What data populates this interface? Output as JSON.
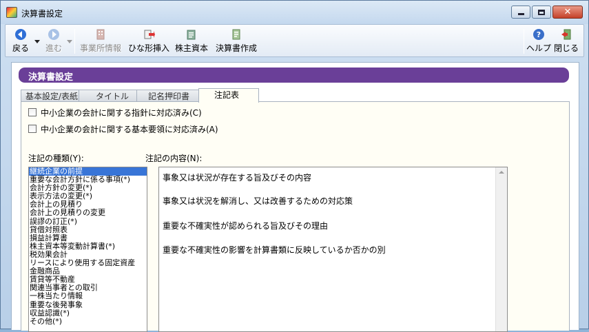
{
  "window": {
    "title": "決算書設定",
    "controls": {
      "minimize": "−",
      "maximize": "□",
      "close": "✕"
    }
  },
  "toolbar": {
    "back": {
      "label": "戻る",
      "icon": "back-arrow-icon"
    },
    "forward": {
      "label": "進む",
      "icon": "forward-arrow-icon"
    },
    "office_info": {
      "label": "事業所情報",
      "icon": "office-building-icon"
    },
    "insert_template": {
      "label": "ひな形挿入",
      "icon": "insert-template-icon"
    },
    "capital": {
      "label": "株主資本",
      "icon": "stock-capital-icon"
    },
    "create_statement": {
      "label": "決算書作成",
      "icon": "create-document-icon"
    },
    "help": {
      "label": "ヘルプ",
      "icon": "help-icon"
    },
    "close": {
      "label": "閉じる",
      "icon": "exit-door-icon"
    }
  },
  "header": {
    "title": "決算書設定"
  },
  "tabs": [
    {
      "label": "基本設定/表紙",
      "active": false
    },
    {
      "label": "タイトル",
      "active": false
    },
    {
      "label": "記名押印書",
      "active": false
    },
    {
      "label": "注記表",
      "active": true
    }
  ],
  "options": {
    "guideline_label": "中小企業の会計に関する指針に対応済み(C)",
    "guideline_checked": false,
    "basic_rule_label": "中小企業の会計に関する基本要領に対応済み(A)",
    "basic_rule_checked": false
  },
  "notes": {
    "kinds_label": "注記の種類(Y):",
    "content_label": "注記の内容(N):",
    "kinds": [
      "継続企業の前提",
      "重要な会計方針に係る事項(*)",
      "会計方針の変更(*)",
      "表示方法の変更(*)",
      "会計上の見積り",
      "会計上の見積りの変更",
      "誤謬の訂正(*)",
      "貸借対照表",
      "損益計算書",
      "株主資本等変動計算書(*)",
      "税効果会計",
      "リースにより使用する固定資産",
      "金融商品",
      "賃貸等不動産",
      "関連当事者との取引",
      "一株当たり情報",
      "重要な後発事象",
      "収益認識(*)",
      "その他(*)"
    ],
    "selected_index": 0,
    "content_lines": [
      "事象又は状況が存在する旨及びその内容",
      "事象又は状況を解消し、又は改善するための対応策",
      "重要な不確実性が認められる旨及びその理由",
      "重要な不確実性の影響を計算書類に反映しているか否かの別"
    ]
  }
}
